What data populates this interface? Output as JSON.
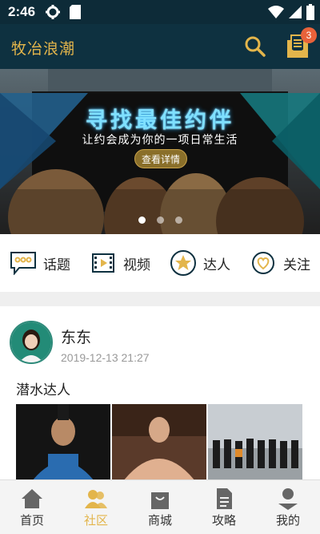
{
  "status_bar": {
    "time": "2:46"
  },
  "header": {
    "title": "牧冶浪潮",
    "message_badge": "3"
  },
  "banner": {
    "headline": "寻找最佳约伴",
    "subtitle": "让约会成为你的一项日常生活",
    "button_label": "查看详情",
    "dots": 3,
    "active_dot": 0
  },
  "categories": [
    {
      "label": "话题",
      "icon": "chat-bubble-icon"
    },
    {
      "label": "视频",
      "icon": "film-icon"
    },
    {
      "label": "达人",
      "icon": "star-badge-icon"
    },
    {
      "label": "关注",
      "icon": "heart-icon"
    }
  ],
  "post": {
    "author": "东东",
    "timestamp": "2019-12-13 21:27",
    "text": "潜水达人"
  },
  "bottom_nav": [
    {
      "label": "首页",
      "icon": "home-icon",
      "active": false
    },
    {
      "label": "社区",
      "icon": "community-icon",
      "active": true
    },
    {
      "label": "商城",
      "icon": "shopping-bag-icon",
      "active": false
    },
    {
      "label": "攻略",
      "icon": "document-icon",
      "active": false
    },
    {
      "label": "我的",
      "icon": "profile-icon",
      "active": false
    }
  ],
  "colors": {
    "header_bg": "#0e3140",
    "accent": "#e3b54b",
    "badge": "#e8623a"
  }
}
